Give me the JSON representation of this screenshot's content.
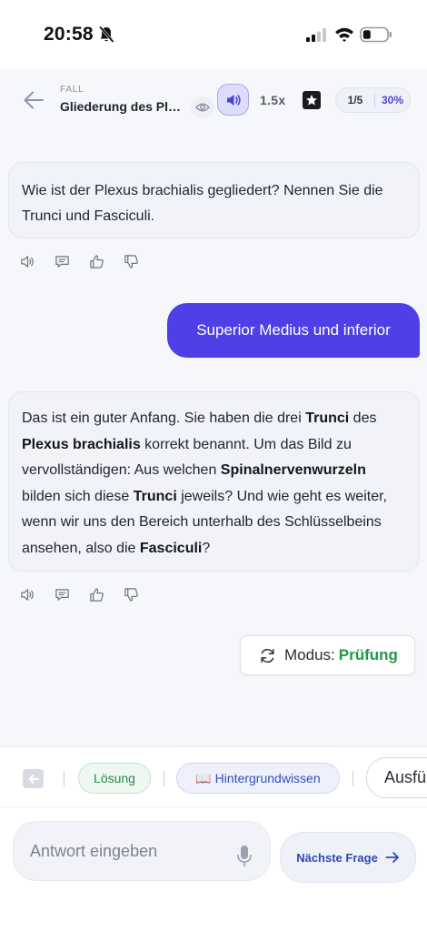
{
  "status_bar": {
    "time": "20:58"
  },
  "header": {
    "case_label": "FALL",
    "case_title": "Gliederung des Plexus brachialis",
    "speed": "1.5x",
    "progress_count": "1/5",
    "progress_percent": "30%"
  },
  "messages": {
    "question": "Wie ist der Plexus brachialis gegliedert? Nennen Sie die Trunci und Fasciculi.",
    "user_answer": "Superior Medius und inferior",
    "feedback_parts": {
      "p1": "Das ist ein guter Anfang. Sie haben die drei ",
      "b1": "Trunci",
      "p2": " des ",
      "b2": "Plexus brachialis",
      "p3": " korrekt benannt. Um das Bild zu vervollständigen: Aus welchen ",
      "b3": "Spinalnervenwurzeln",
      "p4": " bilden sich diese ",
      "b4": "Trunci",
      "p5": " jeweils? Und wie geht es weiter, wenn wir uns den Bereich unterhalb des Schlüsselbeins ansehen, also die ",
      "b5": "Fasciculi",
      "p6": "?"
    }
  },
  "mode": {
    "label": "Modus:",
    "value": "Prüfung"
  },
  "chips": {
    "solution": "Lösung",
    "background": "📖 Hintergrundwissen",
    "explain": "Ausführlich"
  },
  "input": {
    "placeholder": "Antwort eingeben"
  },
  "next": {
    "label": "Nächste Frage"
  },
  "colors": {
    "accent": "#4f3fe6",
    "mode_green": "#1f9a45",
    "link_blue": "#3346b8"
  },
  "icons": {
    "back": "arrow-left-icon",
    "eye": "eye-icon",
    "speaker": "speaker-icon",
    "star": "star-icon",
    "mode": "refresh-icon",
    "mic": "microphone-icon",
    "next": "arrow-right-icon"
  }
}
